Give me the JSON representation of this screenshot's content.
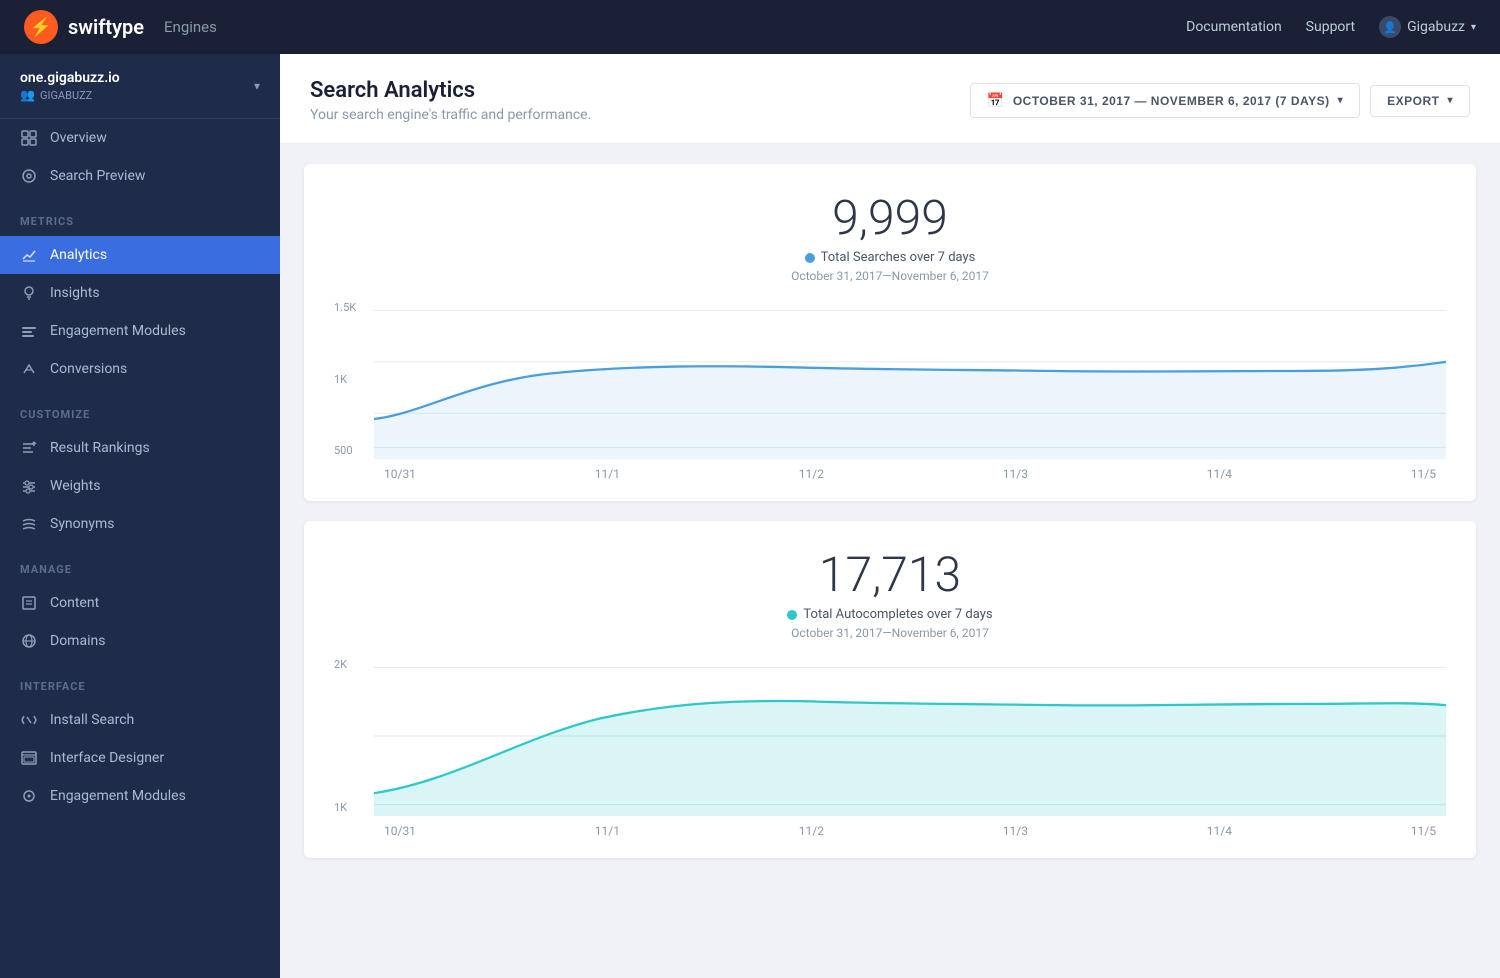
{
  "topnav": {
    "logo_letter": "⚡",
    "logo_name": "swiftype",
    "engines_label": "Engines",
    "doc_label": "Documentation",
    "support_label": "Support",
    "user_label": "Gigabuzz",
    "user_icon": "👤"
  },
  "sidebar": {
    "engine_name": "one.gigabuzz.io",
    "engine_sub": "GIGABUZZ",
    "sections": [
      {
        "label": "",
        "items": [
          {
            "id": "overview",
            "label": "Overview",
            "icon": "overview"
          },
          {
            "id": "search-preview",
            "label": "Search Preview",
            "icon": "preview"
          }
        ]
      },
      {
        "label": "METRICS",
        "items": [
          {
            "id": "analytics",
            "label": "Analytics",
            "icon": "analytics",
            "active": true
          },
          {
            "id": "insights",
            "label": "Insights",
            "icon": "insights"
          },
          {
            "id": "engagement",
            "label": "Engagement Modules",
            "icon": "engagement"
          },
          {
            "id": "conversions",
            "label": "Conversions",
            "icon": "conversions"
          }
        ]
      },
      {
        "label": "CUSTOMIZE",
        "items": [
          {
            "id": "result-rankings",
            "label": "Result Rankings",
            "icon": "rankings"
          },
          {
            "id": "weights",
            "label": "Weights",
            "icon": "weights"
          },
          {
            "id": "synonyms",
            "label": "Synonyms",
            "icon": "synonyms"
          }
        ]
      },
      {
        "label": "MANAGE",
        "items": [
          {
            "id": "content",
            "label": "Content",
            "icon": "content"
          },
          {
            "id": "domains",
            "label": "Domains",
            "icon": "domains"
          }
        ]
      },
      {
        "label": "INTERFACE",
        "items": [
          {
            "id": "install-search",
            "label": "Install Search",
            "icon": "install"
          },
          {
            "id": "interface-designer",
            "label": "Interface Designer",
            "icon": "designer"
          },
          {
            "id": "engagement-modules",
            "label": "Engagement Modules",
            "icon": "engagement2"
          }
        ]
      }
    ]
  },
  "header": {
    "title": "Search Analytics",
    "subtitle": "Your search engine's traffic and performance.",
    "date_range": "OCTOBER 31, 2017 — NOVEMBER 6, 2017 (7 DAYS)",
    "export_label": "EXPORT"
  },
  "charts": [
    {
      "id": "searches",
      "big_number": "9,999",
      "legend_label": "Total Searches over 7 days",
      "legend_color": "#4a9edd",
      "subtitle": "October 31, 2017—November 6, 2017",
      "y_labels": [
        "1.5K",
        "1K",
        "500"
      ],
      "x_labels": [
        "10/31",
        "11/1",
        "11/2",
        "11/3",
        "11/4",
        "11/5"
      ],
      "color": "#4a9edd",
      "fill": "rgba(74,158,221,0.1)"
    },
    {
      "id": "autocompletes",
      "big_number": "17,713",
      "legend_label": "Total Autocompletes over 7 days",
      "legend_color": "#2dc8c8",
      "subtitle": "October 31, 2017—November 6, 2017",
      "y_labels": [
        "2K",
        "1K"
      ],
      "x_labels": [
        "10/31",
        "11/1",
        "11/2",
        "11/3",
        "11/4",
        "11/5"
      ],
      "color": "#2dc8c8",
      "fill": "rgba(45,200,200,0.15)"
    }
  ]
}
